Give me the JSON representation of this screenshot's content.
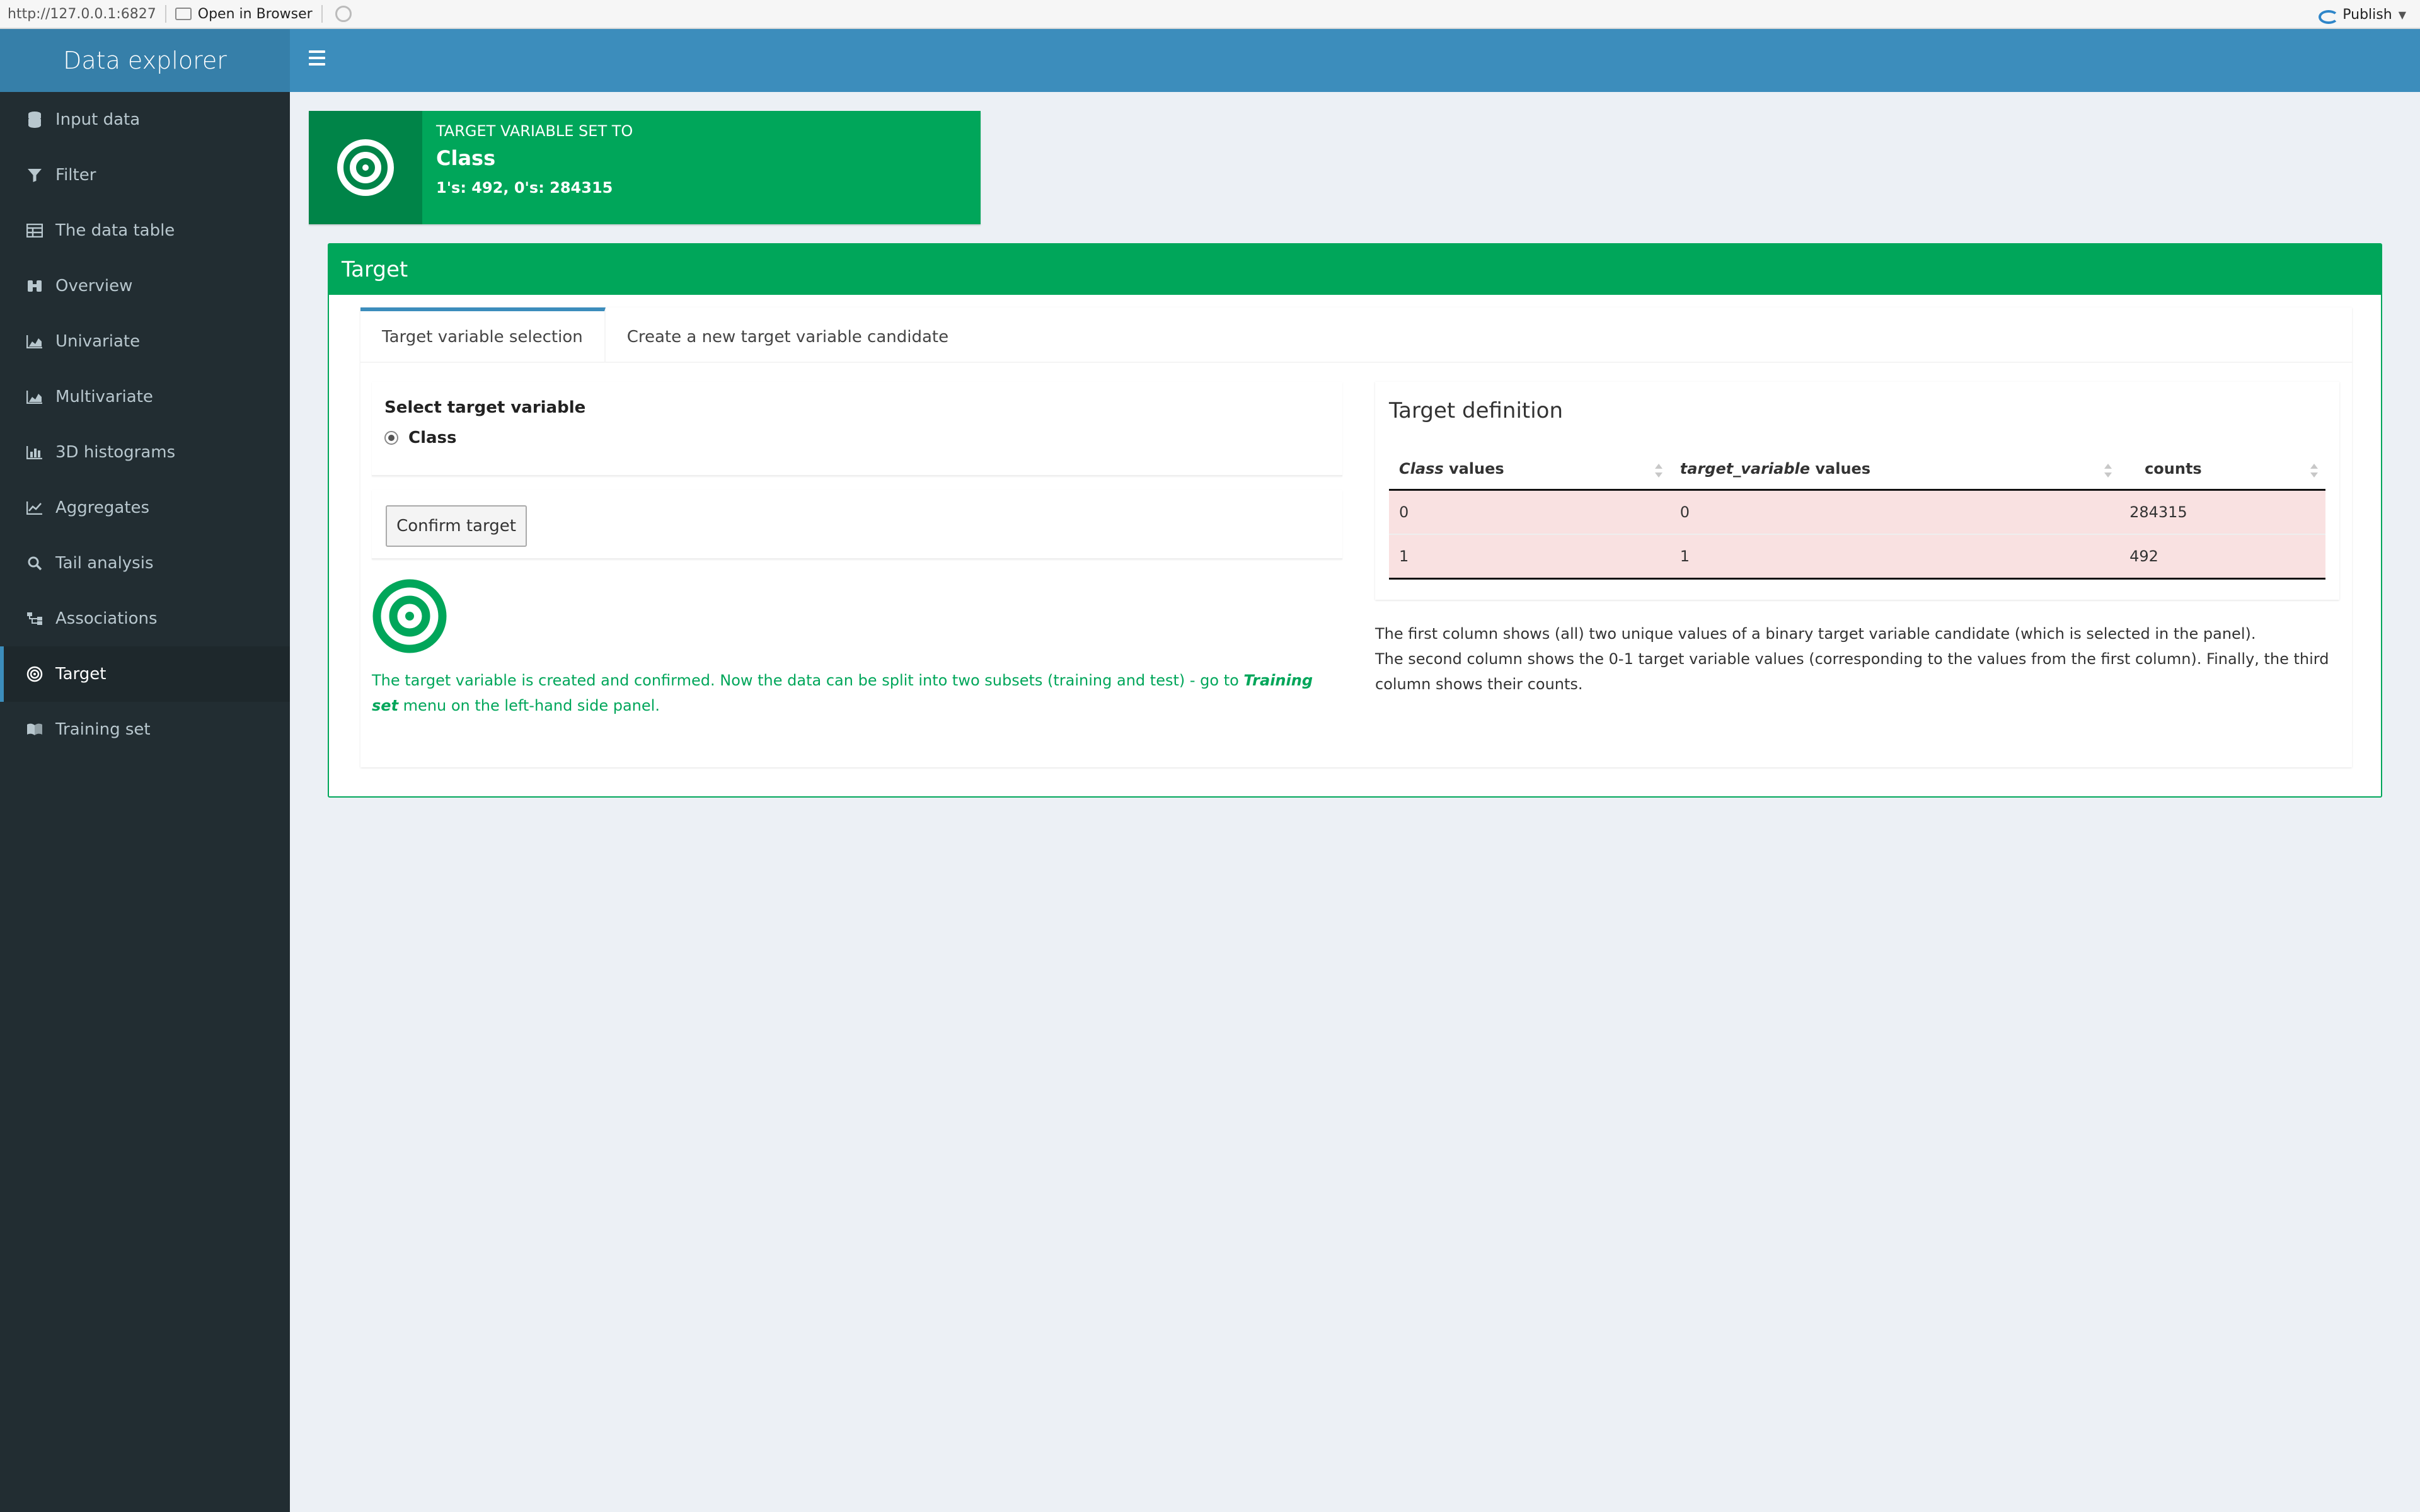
{
  "viewer": {
    "url": "http://127.0.0.1:6827",
    "open_in_browser": "Open in Browser",
    "publish": "Publish"
  },
  "header": {
    "app_title": "Data explorer"
  },
  "sidebar": {
    "items": [
      {
        "label": "Input data",
        "icon": "database-icon"
      },
      {
        "label": "Filter",
        "icon": "filter-icon"
      },
      {
        "label": "The data table",
        "icon": "table-icon"
      },
      {
        "label": "Overview",
        "icon": "binoculars-icon"
      },
      {
        "label": "Univariate",
        "icon": "area-chart-icon"
      },
      {
        "label": "Multivariate",
        "icon": "area-chart-icon"
      },
      {
        "label": "3D histograms",
        "icon": "bar-chart-icon"
      },
      {
        "label": "Aggregates",
        "icon": "line-chart-icon"
      },
      {
        "label": "Tail analysis",
        "icon": "search-icon"
      },
      {
        "label": "Associations",
        "icon": "sitemap-icon"
      },
      {
        "label": "Target",
        "icon": "bullseye-icon",
        "active": true
      },
      {
        "label": "Training set",
        "icon": "book-icon"
      }
    ]
  },
  "infobox": {
    "label": "TARGET VARIABLE SET TO",
    "title": "Class",
    "subtitle": "1's: 492, 0's: 284315"
  },
  "box": {
    "title": "Target",
    "tabs": [
      {
        "label": "Target variable selection",
        "active": true
      },
      {
        "label": "Create a new target variable candidate"
      }
    ],
    "select_label": "Select target variable",
    "radio_option": "Class",
    "confirm_button": "Confirm target",
    "success_message_part1": "The target variable is created and confirmed. Now the data can be split into two subsets (training and test) - go to ",
    "success_message_em": "Training set",
    "success_message_part2": " menu on the left-hand side panel.",
    "definition": {
      "title": "Target definition",
      "columns": [
        {
          "em": "Class",
          "rest": " values"
        },
        {
          "em": "target_variable",
          "rest": " values"
        },
        {
          "em": "",
          "rest": "counts"
        }
      ],
      "rows": [
        [
          "0",
          "0",
          "284315"
        ],
        [
          "1",
          "1",
          "492"
        ]
      ],
      "description_line1": "The first column shows (all) two unique values of a binary target variable candidate (which is selected in the panel).",
      "description_line2": "The second column shows the 0-1 target variable values (corresponding to the values from the first column). Finally, the third column shows their counts."
    }
  },
  "colors": {
    "header_blue": "#3c8dbc",
    "logo_blue": "#367fa9",
    "sidebar_dark": "#222d32",
    "success_green": "#00a65a",
    "row_highlight": "#f9e1e1"
  }
}
